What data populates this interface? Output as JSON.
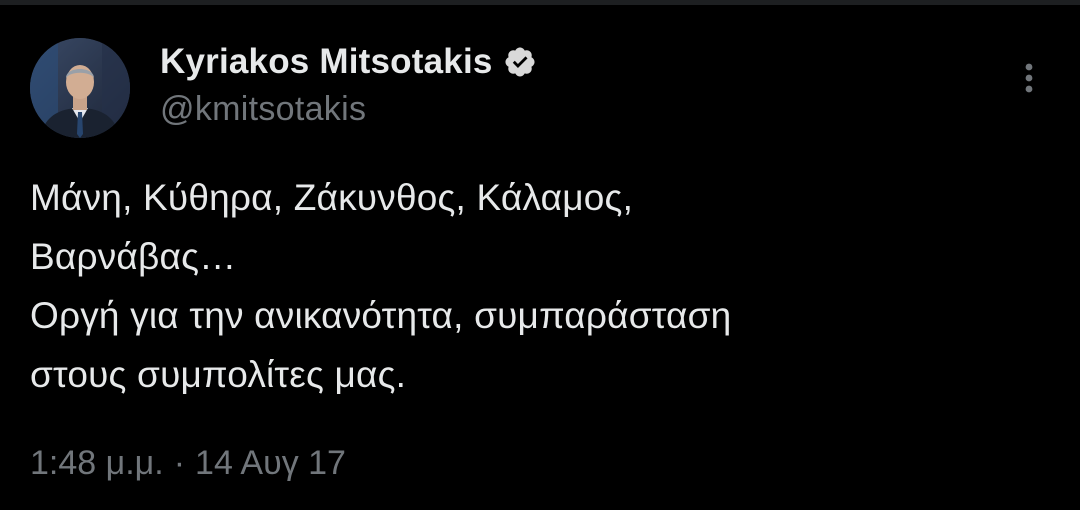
{
  "tweet": {
    "author": {
      "display_name": "Kyriakos Mitsotakis",
      "handle": "@kmitsotakis",
      "verified": true,
      "avatar_icon": "profile-photo"
    },
    "text_lines": [
      "Μάνη, Κύθηρα, Ζάκυνθος, Κάλαμος,",
      "Βαρνάβας…",
      "Οργή για την ανικανότητα, συμπαράσταση",
      "στους συμπολίτες μας."
    ],
    "time": "1:48 μ.μ.",
    "separator": "·",
    "date": "14 Αυγ 17",
    "more_icon": "more-options-icon"
  },
  "colors": {
    "background": "#000000",
    "primary_text": "#e7e9ea",
    "secondary_text": "#71767b",
    "verified_badge": "#d9d9d9"
  }
}
